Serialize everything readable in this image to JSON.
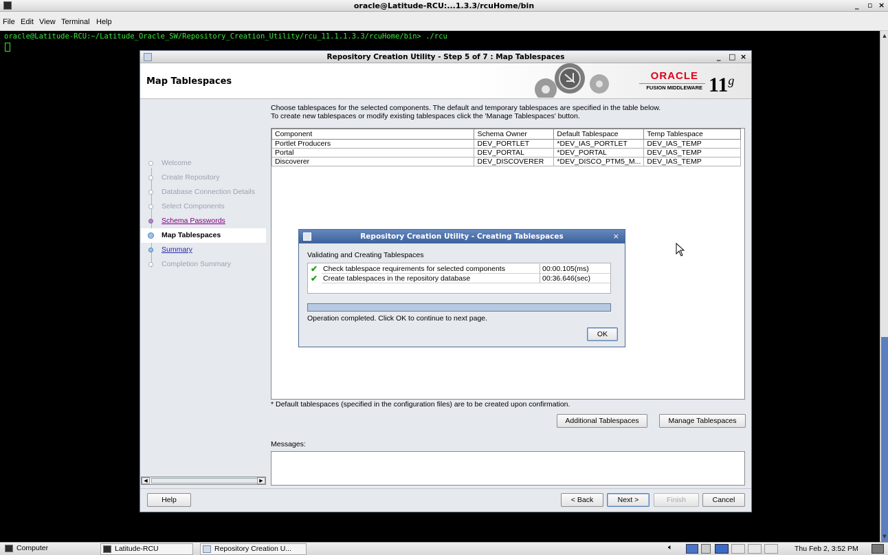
{
  "terminal": {
    "title": "oracle@Latitude-RCU:...1.3.3/rcuHome/bin",
    "menu": [
      "File",
      "Edit",
      "View",
      "Terminal",
      "Help"
    ],
    "command_line": "oracle@Latitude-RCU:~/Latitude_Oracle_SW/Repository_Creation_Utility/rcu_11.1.1.3.3/rcuHome/bin> ./rcu",
    "controls": {
      "minimize": "_",
      "maximize": "▫",
      "close": "×"
    }
  },
  "rcu": {
    "title": "Repository Creation Utility - Step 5 of 7 : Map Tablespaces",
    "page_title": "Map Tablespaces",
    "logo": {
      "oracle": "ORACLE",
      "product": "FUSION MIDDLEWARE",
      "version": "11",
      "version_suffix": "g"
    },
    "controls": {
      "minimize": "_",
      "maximize": "□",
      "close": "×"
    },
    "nav": [
      {
        "label": "Welcome",
        "state": "done"
      },
      {
        "label": "Create Repository",
        "state": "done"
      },
      {
        "label": "Database Connection Details",
        "state": "done"
      },
      {
        "label": "Select Components",
        "state": "done"
      },
      {
        "label": "Schema Passwords",
        "state": "visited"
      },
      {
        "label": "Map Tablespaces",
        "state": "current"
      },
      {
        "label": "Summary",
        "state": "link"
      },
      {
        "label": "Completion Summary",
        "state": "done"
      }
    ],
    "instructions": [
      "Choose tablespaces for the selected components. The default and temporary tablespaces are specified in the table below.",
      "To create new tablespaces or modify existing tablespaces click the 'Manage Tablespaces' button."
    ],
    "table": {
      "columns": [
        "Component",
        "Schema Owner",
        "Default Tablespace",
        "Temp Tablespace"
      ],
      "rows": [
        [
          "Portlet Producers",
          "DEV_PORTLET",
          "*DEV_IAS_PORTLET",
          "DEV_IAS_TEMP"
        ],
        [
          "Portal",
          "DEV_PORTAL",
          "*DEV_PORTAL",
          "DEV_IAS_TEMP"
        ],
        [
          "Discoverer",
          "DEV_DISCOVERER",
          "*DEV_DISCO_PTM5_M...",
          "DEV_IAS_TEMP"
        ]
      ]
    },
    "footnote": "* Default tablespaces (specified in the configuration files) are to be created upon confirmation.",
    "buttons": {
      "additional": "Additional Tablespaces",
      "manage": "Manage Tablespaces",
      "help": "Help",
      "back": "< Back",
      "next": "Next >",
      "finish": "Finish",
      "cancel": "Cancel"
    },
    "messages_label": "Messages:"
  },
  "progress_dialog": {
    "title": "Repository Creation Utility - Creating Tablespaces",
    "heading": "Validating and Creating Tablespaces",
    "tasks": [
      {
        "label": "Check tablespace requirements for selected components",
        "time": "00:00.105(ms)"
      },
      {
        "label": "Create tablespaces in the repository database",
        "time": "00:36.646(sec)"
      }
    ],
    "progress": 1.0,
    "status": "Operation completed. Click OK to continue to next page.",
    "ok_label": "OK",
    "close": "×"
  },
  "taskbar": {
    "items": [
      "Computer",
      "Latitude-RCU",
      "Repository Creation U..."
    ],
    "clock": "Thu Feb  2,  3:52 PM"
  }
}
